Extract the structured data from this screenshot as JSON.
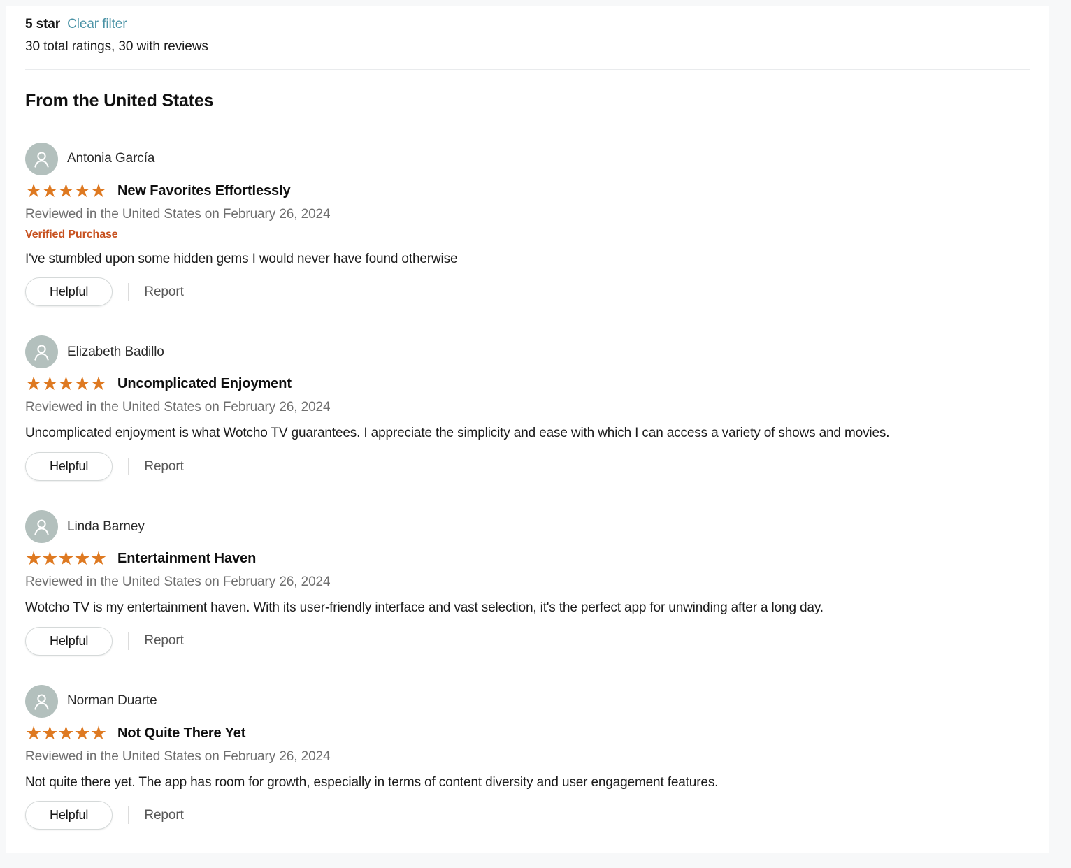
{
  "filter": {
    "star_label": "5 star",
    "clear_filter_label": "Clear filter",
    "ratings_summary": "30 total ratings, 30 with reviews",
    "link_color": "#4b93a6"
  },
  "section": {
    "country_heading": "From the United States"
  },
  "labels": {
    "helpful": "Helpful",
    "report": "Report",
    "verified_purchase": "Verified Purchase",
    "stars_glyph": "★★★★★"
  },
  "colors": {
    "star": "#de7921",
    "verified": "#c7511f",
    "avatar_bg": "#b3c0bd",
    "page_bg": "#f7f8f9",
    "card_bg": "#ffffff"
  },
  "reviews": [
    {
      "reviewer": "Antonia García",
      "rating": 5,
      "stars": "★★★★★",
      "title": "New Favorites Effortlessly",
      "meta": "Reviewed in the United States on February 26, 2024",
      "verified": "Verified Purchase",
      "body": "I've stumbled upon some hidden gems I would never have found otherwise",
      "helpful": "Helpful",
      "report": "Report"
    },
    {
      "reviewer": "Elizabeth Badillo",
      "rating": 5,
      "stars": "★★★★★",
      "title": "Uncomplicated Enjoyment",
      "meta": "Reviewed in the United States on February 26, 2024",
      "verified": "",
      "body": "Uncomplicated enjoyment is what Wotcho TV guarantees. I appreciate the simplicity and ease with which I can access a variety of shows and movies.",
      "helpful": "Helpful",
      "report": "Report"
    },
    {
      "reviewer": "Linda Barney",
      "rating": 5,
      "stars": "★★★★★",
      "title": "Entertainment Haven",
      "meta": "Reviewed in the United States on February 26, 2024",
      "verified": "",
      "body": "Wotcho TV is my entertainment haven. With its user-friendly interface and vast selection, it's the perfect app for unwinding after a long day.",
      "helpful": "Helpful",
      "report": "Report"
    },
    {
      "reviewer": "Norman Duarte",
      "rating": 5,
      "stars": "★★★★★",
      "title": "Not Quite There Yet",
      "meta": "Reviewed in the United States on February 26, 2024",
      "verified": "",
      "body": "Not quite there yet. The app has room for growth, especially in terms of content diversity and user engagement features.",
      "helpful": "Helpful",
      "report": "Report"
    }
  ]
}
